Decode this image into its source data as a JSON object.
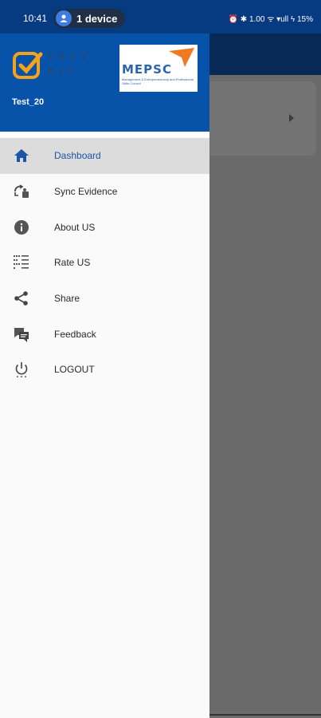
{
  "status_bar": {
    "time": "10:41",
    "device_label": "1 device",
    "right_text": "⏰ ✱ 1.00 ᯤ ▾ull ϟ 15%"
  },
  "drawer": {
    "brand_logo_text": "TEST KIT",
    "partner_logo_text": "MEPSC",
    "partner_logo_subtext": "Management & Entrepreneurship and Professional Skills Council",
    "user_name": "Test_20",
    "items": [
      {
        "label": "Dashboard",
        "icon": "home-icon",
        "active": true
      },
      {
        "label": "Sync Evidence",
        "icon": "sync-icon",
        "active": false
      },
      {
        "label": "About US",
        "icon": "info-icon",
        "active": false
      },
      {
        "label": "Rate US",
        "icon": "rate-icon",
        "active": false
      },
      {
        "label": "Share",
        "icon": "share-icon",
        "active": false
      },
      {
        "label": "Feedback",
        "icon": "feedback-icon",
        "active": false
      },
      {
        "label": "LOGOUT",
        "icon": "power-icon",
        "active": false
      }
    ]
  },
  "colors": {
    "header_blue": "#0753aa",
    "status_blue": "#063b82",
    "active_text": "#1a55a8",
    "brand_orange": "#f5a31a"
  }
}
